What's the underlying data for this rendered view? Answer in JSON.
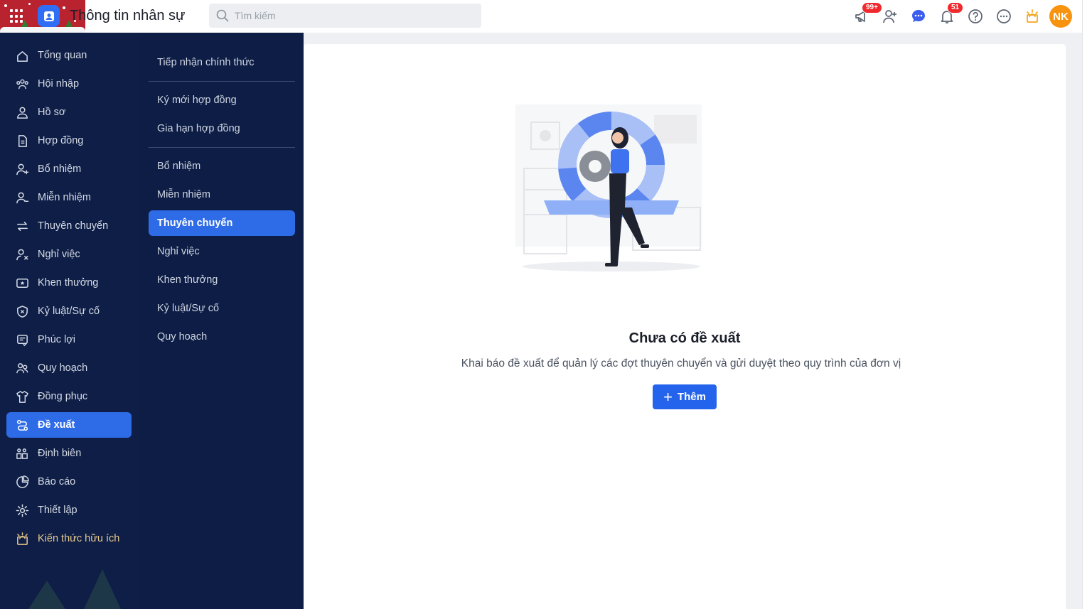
{
  "header": {
    "app_title": "Thông tin nhân sự",
    "search_placeholder": "Tìm kiếm",
    "announcement_badge": "99+",
    "notification_badge": "51",
    "avatar_initials": "NK",
    "icons": [
      "apps-grid-icon",
      "megaphone-icon",
      "add-user-icon",
      "chat-icon",
      "bell-icon",
      "help-icon",
      "more-icon",
      "sun-icon"
    ],
    "avatar_color": "#f7930f"
  },
  "sidebar": {
    "items": [
      {
        "label": "Tổng quan",
        "icon": "home-icon"
      },
      {
        "label": "Hội nhập",
        "icon": "onboarding-icon"
      },
      {
        "label": "Hồ sơ",
        "icon": "profile-icon"
      },
      {
        "label": "Hợp đồng",
        "icon": "contract-icon"
      },
      {
        "label": "Bổ nhiệm",
        "icon": "appoint-icon"
      },
      {
        "label": "Miễn nhiệm",
        "icon": "dismiss-icon"
      },
      {
        "label": "Thuyên chuyển",
        "icon": "transfer-icon"
      },
      {
        "label": "Nghỉ việc",
        "icon": "resign-icon"
      },
      {
        "label": "Khen thưởng",
        "icon": "reward-icon"
      },
      {
        "label": "Kỷ luật/Sự cố",
        "icon": "discipline-icon"
      },
      {
        "label": "Phúc lợi",
        "icon": "benefit-icon"
      },
      {
        "label": "Quy hoạch",
        "icon": "planning-icon"
      },
      {
        "label": "Đồng phục",
        "icon": "uniform-icon"
      },
      {
        "label": "Đề xuất",
        "icon": "proposal-icon",
        "active": true
      },
      {
        "label": "Định biên",
        "icon": "headcount-icon"
      },
      {
        "label": "Báo cáo",
        "icon": "report-icon"
      },
      {
        "label": "Thiết lập",
        "icon": "settings-icon"
      },
      {
        "label": "Kiến thức hữu ích",
        "icon": "knowledge-icon"
      }
    ]
  },
  "submenu": {
    "groups": [
      [
        "Tiếp nhận chính thức"
      ],
      [
        "Ký mới hợp đồng",
        "Gia hạn hợp đồng"
      ],
      [
        "Bổ nhiệm",
        "Miễn nhiệm",
        "Thuyên chuyển",
        "Nghỉ việc",
        "Khen thưởng",
        "Kỷ luật/Sự cố",
        "Quy hoạch"
      ]
    ],
    "active": "Thuyên chuyển"
  },
  "main": {
    "empty_title": "Chưa có đề xuất",
    "empty_desc": "Khai báo đề xuất để quản lý các đợt thuyên chuyển và gửi duyệt theo quy trình của đơn vị",
    "add_label": "Thêm",
    "accent_color": "#2463eb"
  }
}
